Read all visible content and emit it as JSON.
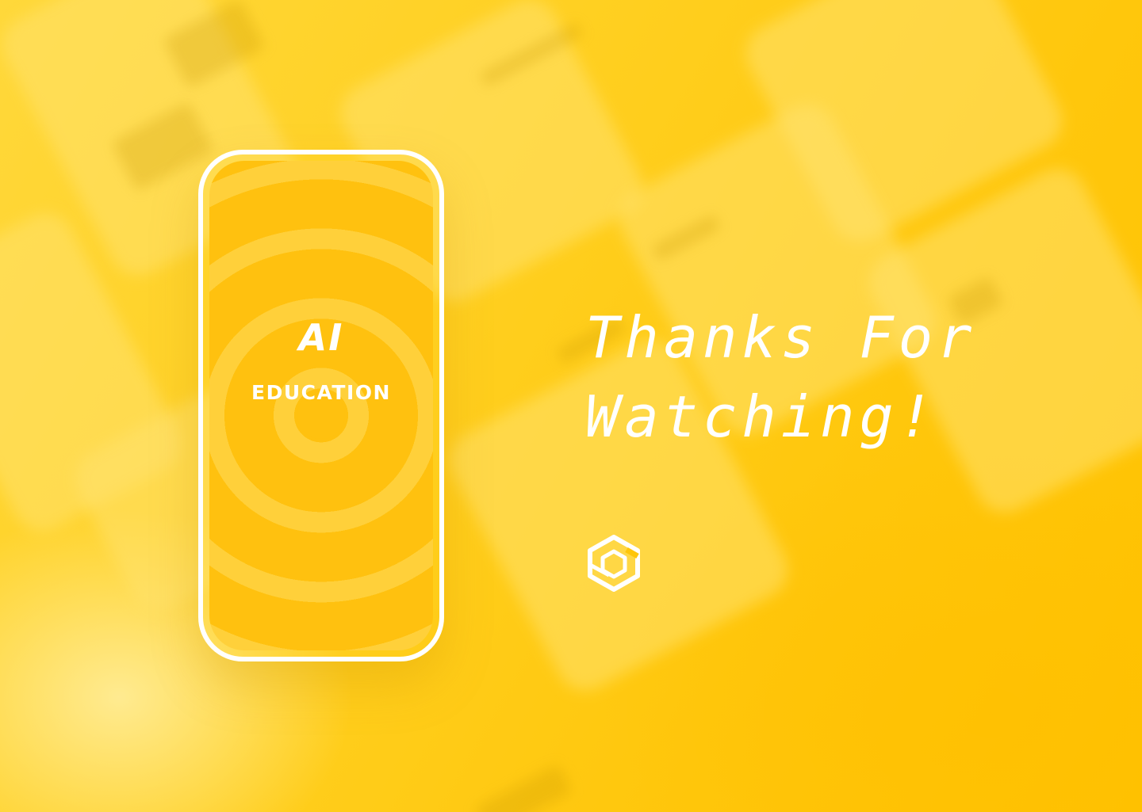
{
  "phone": {
    "title": "AI",
    "subtitle": "EDUCATION"
  },
  "closing": {
    "line1": "Thanks For",
    "line2": "Watching!"
  },
  "logo": {
    "icon": "hexagon-logo-icon"
  },
  "colors": {
    "background": "#FFC60A",
    "screen_ring_dark": "#FFC10F",
    "screen_ring_light": "#FFD03A",
    "text": "#FFFFFF"
  }
}
